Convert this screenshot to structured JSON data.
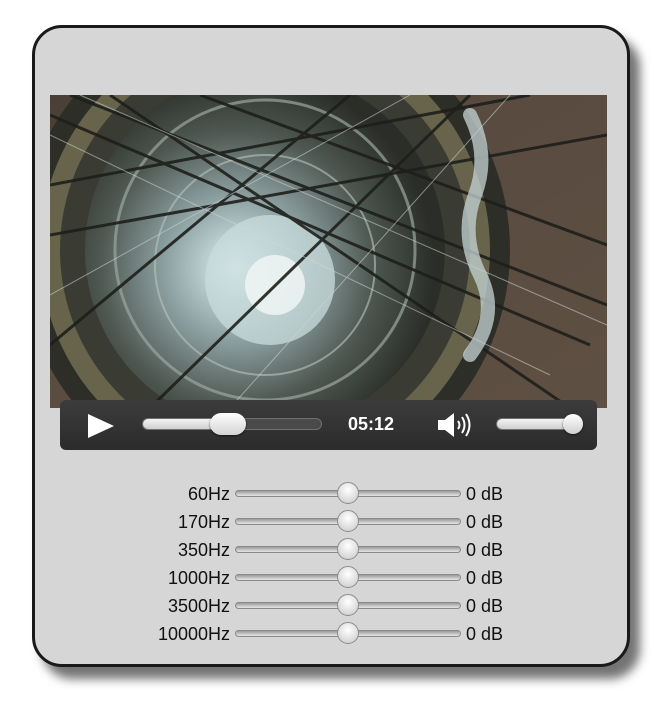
{
  "player": {
    "play_icon": "play-icon",
    "seek_progress": 0.48,
    "time": "05:12",
    "volume_icon": "speaker-icon",
    "volume_level": 1.0
  },
  "equalizer": {
    "bands": [
      {
        "label": "60Hz",
        "value": "0 dB",
        "level": 0.5
      },
      {
        "label": "170Hz",
        "value": "0 dB",
        "level": 0.5
      },
      {
        "label": "350Hz",
        "value": "0 dB",
        "level": 0.5
      },
      {
        "label": "1000Hz",
        "value": "0 dB",
        "level": 0.5
      },
      {
        "label": "3500Hz",
        "value": "0 dB",
        "level": 0.5
      },
      {
        "label": "10000Hz",
        "value": "0 dB",
        "level": 0.5
      }
    ]
  },
  "colors": {
    "panel": "#d6d6d6",
    "controls_bar": "#333333",
    "text": "#111111"
  }
}
